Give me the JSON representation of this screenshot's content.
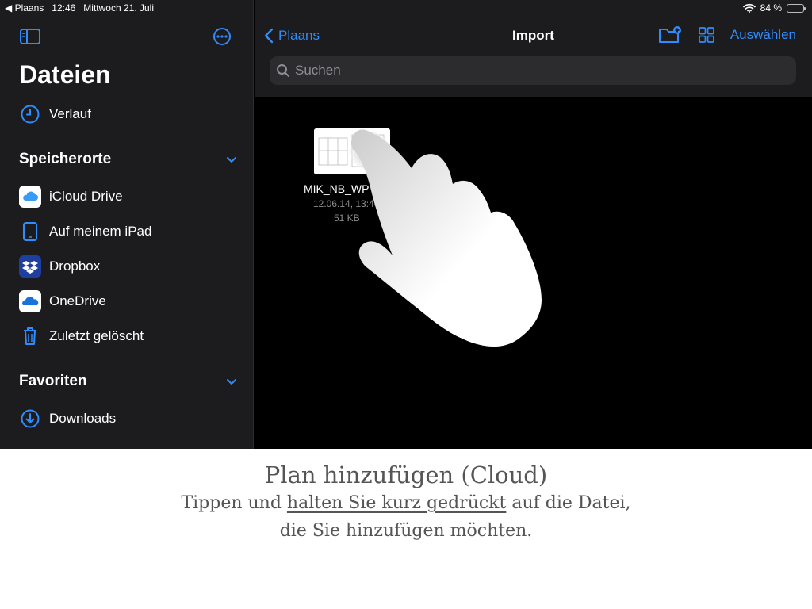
{
  "status_bar": {
    "back_app": "◀ Plaans",
    "time": "12:46",
    "date": "Mittwoch 21. Juli",
    "battery": "84 %",
    "battery_level": 0.84
  },
  "sidebar": {
    "title": "Dateien",
    "recent_label": "Verlauf",
    "locations_header": "Speicherorte",
    "locations": [
      {
        "label": "iCloud Drive",
        "icon": "icloud-icon"
      },
      {
        "label": "Auf meinem iPad",
        "icon": "ipad-icon"
      },
      {
        "label": "Dropbox",
        "icon": "dropbox-icon"
      },
      {
        "label": "OneDrive",
        "icon": "onedrive-icon"
      },
      {
        "label": "Zuletzt gelöscht",
        "icon": "trash-icon"
      }
    ],
    "favorites_header": "Favoriten",
    "favorites": [
      {
        "label": "Downloads",
        "icon": "download-icon"
      }
    ]
  },
  "main": {
    "back_label": "Plaans",
    "title": "Import",
    "select_label": "Auswählen",
    "search_placeholder": "Suchen",
    "file": {
      "name": "MIK_NB_WP-",
      "date": "12.06.14, 13:46",
      "size": "51 KB"
    }
  },
  "caption": {
    "title": "Plan hinzufügen (Cloud)",
    "line1_before": "Tippen und ",
    "line1_emph": "halten Sie kurz gedrückt",
    "line1_after": " auf die Datei,",
    "line2": "die Sie hinzufügen möchten."
  },
  "colors": {
    "accent": "#2f8cff",
    "sidebar_bg": "#1c1c1e",
    "content_bg": "#000000"
  }
}
